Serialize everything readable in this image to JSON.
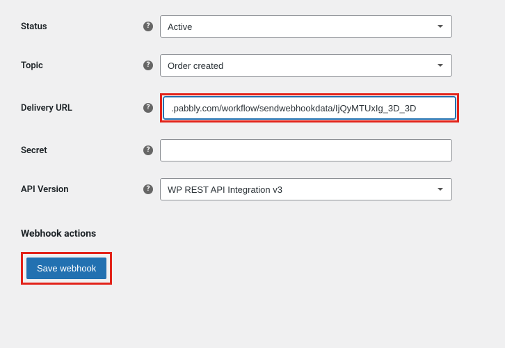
{
  "fields": {
    "status": {
      "label": "Status",
      "value": "Active"
    },
    "topic": {
      "label": "Topic",
      "value": "Order created"
    },
    "delivery_url": {
      "label": "Delivery URL",
      "value": ".pabbly.com/workflow/sendwebhookdata/IjQyMTUxIg_3D_3D"
    },
    "secret": {
      "label": "Secret",
      "value": ""
    },
    "api_version": {
      "label": "API Version",
      "value": "WP REST API Integration v3"
    }
  },
  "section_heading": "Webhook actions",
  "buttons": {
    "save": "Save webhook"
  }
}
